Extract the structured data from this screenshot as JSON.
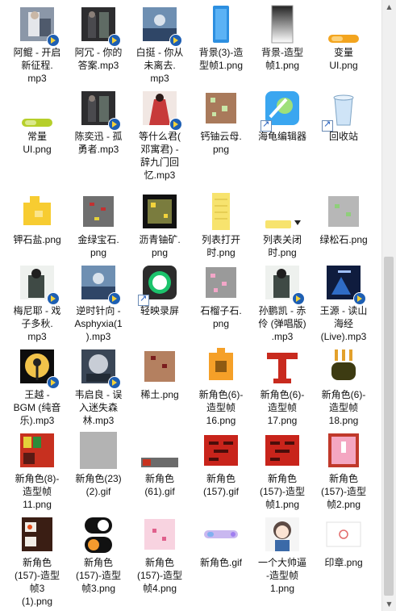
{
  "files": [
    {
      "label": "阿鲲 - 开启\n新征程.\nmp3",
      "icon": "music-file-icon",
      "thumb": "photo"
    },
    {
      "label": "阿冗 - 你的\n答案.mp3",
      "icon": "music-file-icon",
      "thumb": "photo-dark"
    },
    {
      "label": "白挺 - 你从\n未离去.\nmp3",
      "icon": "music-file-icon",
      "thumb": "photo-blue"
    },
    {
      "label": "背景(3)-造\n型帧1.png",
      "icon": "image-file-icon",
      "thumb": "tall-blue"
    },
    {
      "label": "背景-造型\n帧1.png",
      "icon": "image-file-icon",
      "thumb": "gradient"
    },
    {
      "label": "变量\nUI.png",
      "icon": "image-file-icon",
      "thumb": "orange-pill"
    },
    {
      "label": "常量\nUI.png",
      "icon": "image-file-icon",
      "thumb": "green-pill"
    },
    {
      "label": "陈奕迅 - 孤\n勇者.mp3",
      "icon": "music-file-icon",
      "thumb": "photo-dark"
    },
    {
      "label": "等什么君(\n邓寓君) -\n辞九门回\n忆.mp3",
      "icon": "music-file-icon",
      "thumb": "photo-red"
    },
    {
      "label": "钙铀云母.\npng",
      "icon": "image-file-icon",
      "thumb": "brown-square"
    },
    {
      "label": "海龟编辑器",
      "icon": "turtle-app-icon",
      "thumb": "app"
    },
    {
      "label": "回收站",
      "icon": "recycle-bin-icon",
      "thumb": "bin"
    },
    {
      "label": "钾石盐.png",
      "icon": "image-file-icon",
      "thumb": "yellow-blocks"
    },
    {
      "label": "金绿宝石.\npng",
      "icon": "image-file-icon",
      "thumb": "gray-square"
    },
    {
      "label": "沥青铀矿.\npng",
      "icon": "image-file-icon",
      "thumb": "black-square"
    },
    {
      "label": "列表打开\n时.png",
      "icon": "image-file-icon",
      "thumb": "yellow-list"
    },
    {
      "label": "列表关闭\n时.png",
      "icon": "image-file-icon",
      "thumb": "yellow-bar"
    },
    {
      "label": "绿松石.png",
      "icon": "image-file-icon",
      "thumb": "light-gray"
    },
    {
      "label": "梅尼耶 - 戏\n子多秋.\nmp3",
      "icon": "music-file-icon",
      "thumb": "photo-light"
    },
    {
      "label": "逆时针向 -\nAsphyxia(1\n).mp3",
      "icon": "music-file-icon",
      "thumb": "photo-blue"
    },
    {
      "label": "轻映录屏",
      "icon": "record-app-icon",
      "thumb": "record"
    },
    {
      "label": "石榴子石.\npng",
      "icon": "image-file-icon",
      "thumb": "pink-square"
    },
    {
      "label": "孙鹏凯 - 赤\n伶 (弹唱版)\n.mp3",
      "icon": "music-file-icon",
      "thumb": "photo-light"
    },
    {
      "label": "王源 - 读山\n海经\n(Live).mp3",
      "icon": "music-file-icon",
      "thumb": "photo-navy"
    },
    {
      "label": "王越 -\nBGM (纯音\n乐).mp3",
      "icon": "music-file-icon",
      "thumb": "photo-moon"
    },
    {
      "label": "韦启良 - 误\n入迷失森\n林.mp3",
      "icon": "music-file-icon",
      "thumb": "photo-gray"
    },
    {
      "label": "稀土.png",
      "icon": "image-file-icon",
      "thumb": "brown-light"
    },
    {
      "label": "新角色(6)-\n造型帧\n16.png",
      "icon": "image-file-icon",
      "thumb": "orange-seal"
    },
    {
      "label": "新角色(6)-\n造型帧\n17.png",
      "icon": "image-file-icon",
      "thumb": "red-t"
    },
    {
      "label": "新角色(6)-\n造型帧\n18.png",
      "icon": "image-file-icon",
      "thumb": "green-pot"
    },
    {
      "label": "新角色(8)-\n造型帧\n11.png",
      "icon": "image-file-icon",
      "thumb": "shelf"
    },
    {
      "label": "新角色(23)\n(2).gif",
      "icon": "image-file-icon",
      "thumb": "gray-plain"
    },
    {
      "label": "新角色\n(61).gif",
      "icon": "image-file-icon",
      "thumb": "thin-bar"
    },
    {
      "label": "新角色\n(157).gif",
      "icon": "image-file-icon",
      "thumb": "brick"
    },
    {
      "label": "新角色\n(157)-造型\n帧1.png",
      "icon": "image-file-icon",
      "thumb": "brick"
    },
    {
      "label": "新角色\n(157)-造型\n帧2.png",
      "icon": "image-file-icon",
      "thumb": "pink-box"
    },
    {
      "label": "新角色\n(157)-造型\n帧3\n(1).png",
      "icon": "image-file-icon",
      "thumb": "dark-box"
    },
    {
      "label": "新角色\n(157)-造型\n帧3.png",
      "icon": "image-file-icon",
      "thumb": "toggle"
    },
    {
      "label": "新角色\n(157)-造型\n帧4.png",
      "icon": "image-file-icon",
      "thumb": "pink-light"
    },
    {
      "label": "新角色.gif",
      "icon": "image-file-icon",
      "thumb": "pastel-bar"
    },
    {
      "label": "一个大帅逼\n-造型帧\n1.png",
      "icon": "image-file-icon",
      "thumb": "anime"
    },
    {
      "label": "印章.png",
      "icon": "image-file-icon",
      "thumb": "stamp"
    }
  ]
}
